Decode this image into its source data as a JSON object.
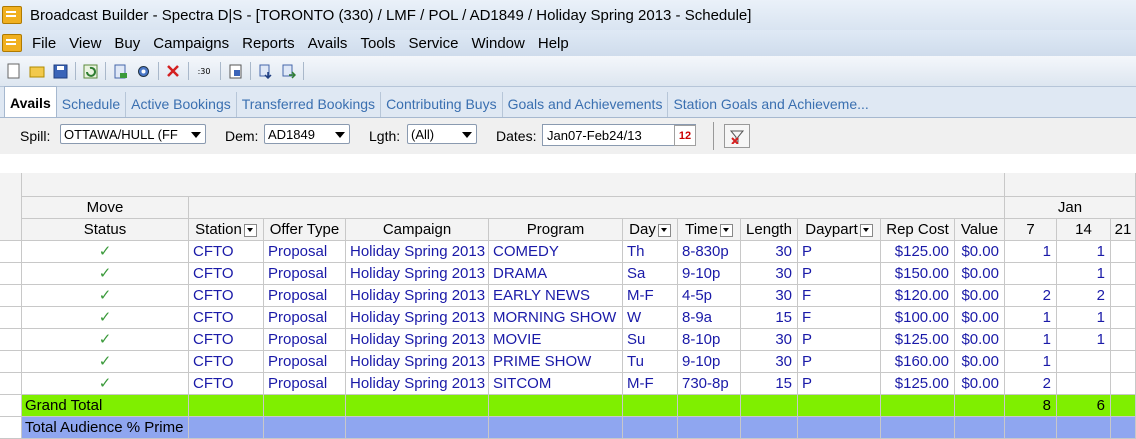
{
  "window": {
    "title": "Broadcast Builder - Spectra D|S - [TORONTO (330) / LMF / POL / AD1849 / Holiday Spring 2013 - Schedule]"
  },
  "menu": [
    "File",
    "View",
    "Buy",
    "Campaigns",
    "Reports",
    "Avails",
    "Tools",
    "Service",
    "Window",
    "Help"
  ],
  "toolbar": {
    "icons": [
      "new-document-icon",
      "open-folder-icon",
      "save-icon",
      "refresh-icon",
      "export-icon",
      "settings-icon",
      "delete-icon",
      "counter-icon",
      "print-preview-icon",
      "import-down-icon",
      "import-right-icon"
    ],
    "counter_label": ":30"
  },
  "tabs": [
    "Avails",
    "Schedule",
    "Active Bookings",
    "Transferred Bookings",
    "Contributing Buys",
    "Goals and Achievements",
    "Station Goals and Achieveme..."
  ],
  "filters": {
    "spill_label": "Spill:",
    "spill_value": "OTTAWA/HULL (FF",
    "dem_label": "Dem:",
    "dem_value": "AD1849",
    "lgth_label": "Lgth:",
    "lgth_value": "(All)",
    "dates_label": "Dates:",
    "dates_value": "Jan07-Feb24/13",
    "calendar_label": "12"
  },
  "grid": {
    "group_header": "Move",
    "month_header": "Jan",
    "columns": [
      "Status",
      "Station",
      "Offer Type",
      "Campaign",
      "Program",
      "Day",
      "Time",
      "Length",
      "Daypart",
      "Rep Cost",
      "Value",
      "7",
      "14",
      "21"
    ],
    "rows": [
      {
        "station": "CFTO",
        "offer": "Proposal",
        "campaign": "Holiday Spring 2013",
        "program": "COMEDY",
        "day": "Th",
        "time": "8-830p",
        "length": "30",
        "daypart": "P",
        "rep_cost": "$125.00",
        "value": "$0.00",
        "w7": "1",
        "w14": "1"
      },
      {
        "station": "CFTO",
        "offer": "Proposal",
        "campaign": "Holiday Spring 2013",
        "program": "DRAMA",
        "day": "Sa",
        "time": "9-10p",
        "length": "30",
        "daypart": "P",
        "rep_cost": "$150.00",
        "value": "$0.00",
        "w7": "",
        "w14": "1"
      },
      {
        "station": "CFTO",
        "offer": "Proposal",
        "campaign": "Holiday Spring 2013",
        "program": "EARLY NEWS",
        "day": "M-F",
        "time": "4-5p",
        "length": "30",
        "daypart": "F",
        "rep_cost": "$120.00",
        "value": "$0.00",
        "w7": "2",
        "w14": "2"
      },
      {
        "station": "CFTO",
        "offer": "Proposal",
        "campaign": "Holiday Spring 2013",
        "program": "MORNING SHOW",
        "day": "W",
        "time": "8-9a",
        "length": "15",
        "daypart": "F",
        "rep_cost": "$100.00",
        "value": "$0.00",
        "w7": "1",
        "w14": "1"
      },
      {
        "station": "CFTO",
        "offer": "Proposal",
        "campaign": "Holiday Spring 2013",
        "program": "MOVIE",
        "day": "Su",
        "time": "8-10p",
        "length": "30",
        "daypart": "P",
        "rep_cost": "$125.00",
        "value": "$0.00",
        "w7": "1",
        "w14": "1"
      },
      {
        "station": "CFTO",
        "offer": "Proposal",
        "campaign": "Holiday Spring 2013",
        "program": "PRIME SHOW",
        "day": "Tu",
        "time": "9-10p",
        "length": "30",
        "daypart": "P",
        "rep_cost": "$160.00",
        "value": "$0.00",
        "w7": "1",
        "w14": ""
      },
      {
        "station": "CFTO",
        "offer": "Proposal",
        "campaign": "Holiday Spring 2013",
        "program": "SITCOM",
        "day": "M-F",
        "time": "730-8p",
        "length": "15",
        "daypart": "P",
        "rep_cost": "$125.00",
        "value": "$0.00",
        "w7": "2",
        "w14": ""
      }
    ],
    "status_mark": "✓",
    "grand_total": {
      "label": "Grand Total",
      "w7": "8",
      "w14": "6"
    },
    "audience_label": "Total Audience % Prime"
  },
  "colors": {
    "grand_total": "#7fef00",
    "audience": "#8fa6f0",
    "link": "#1a1aa8",
    "check": "#3a9a3a"
  }
}
